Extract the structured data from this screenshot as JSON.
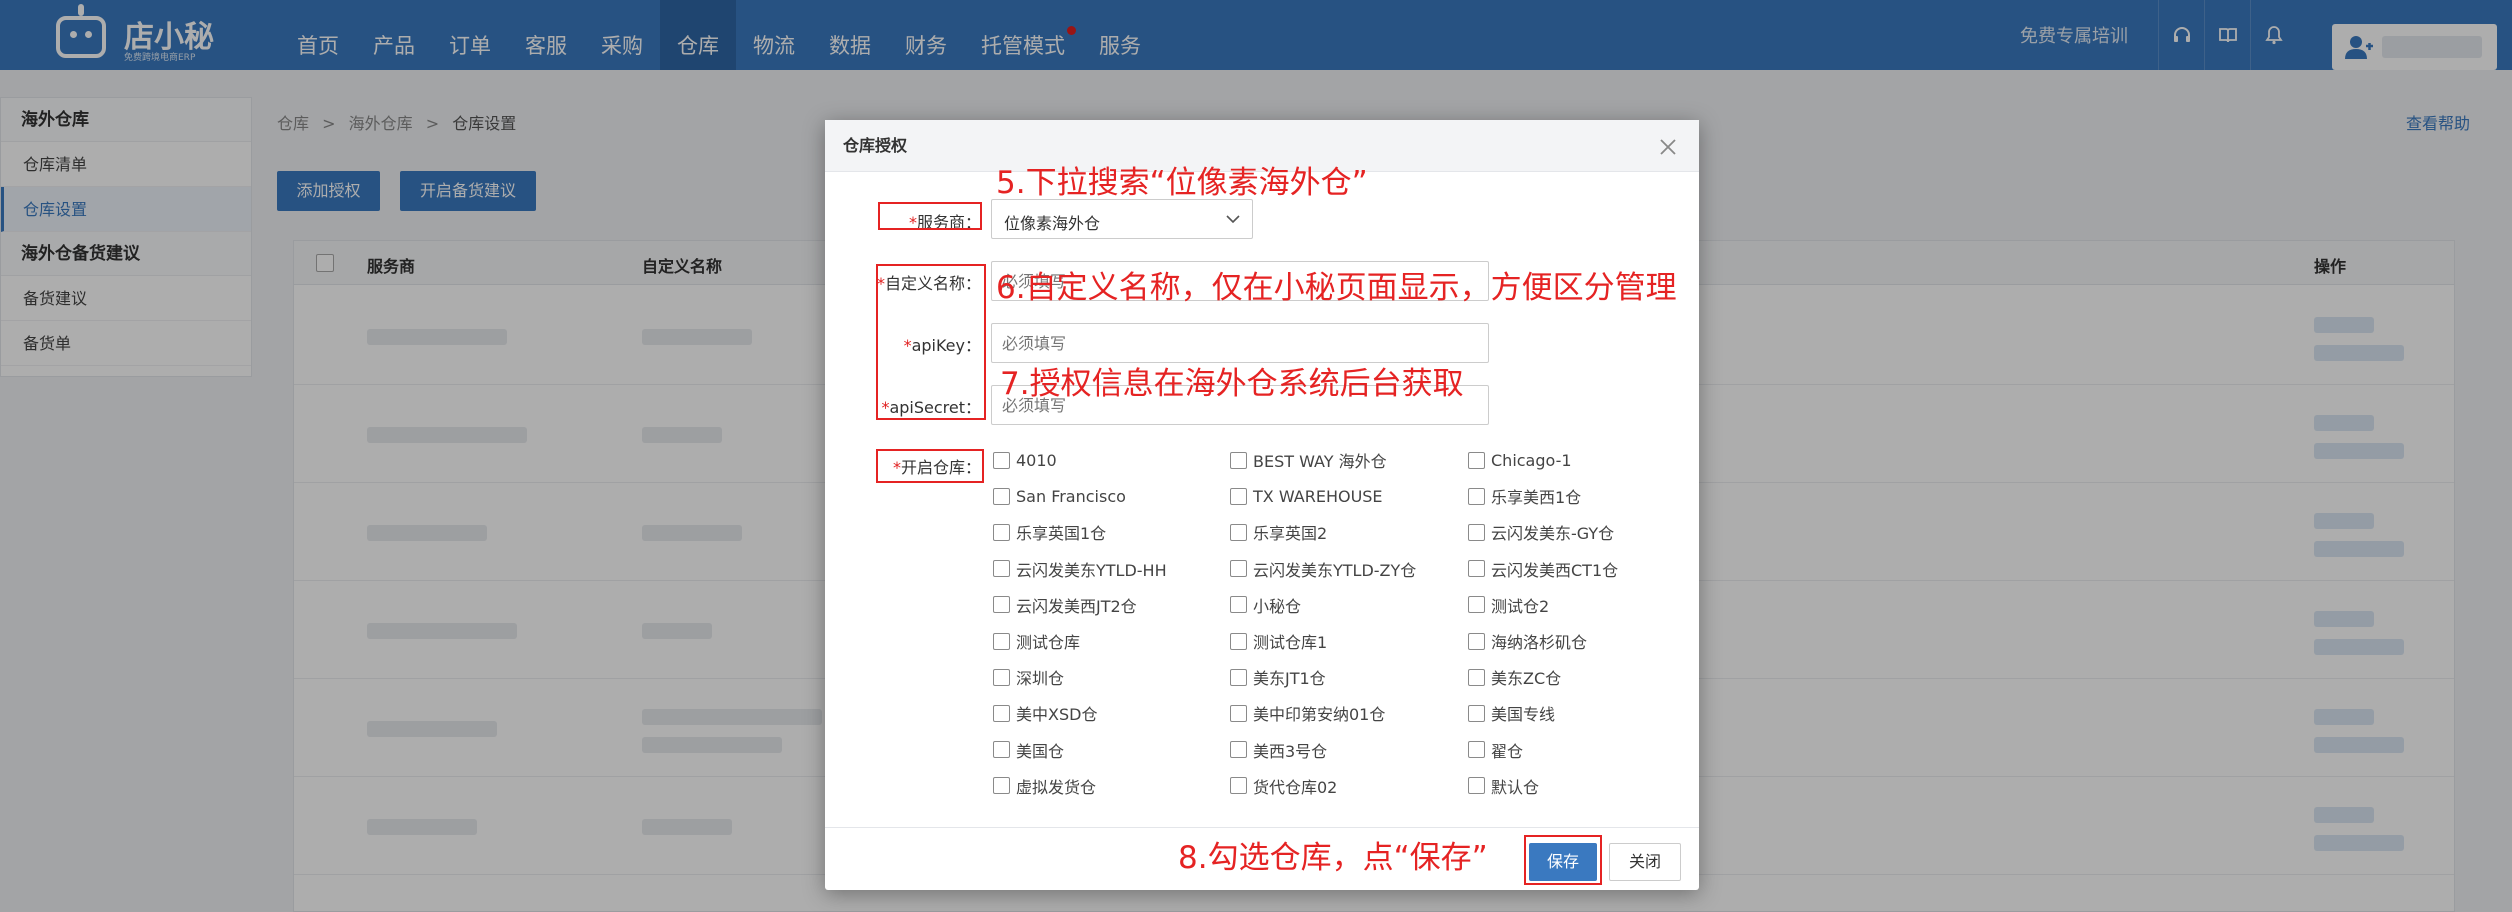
{
  "app": {
    "logo_text": "店小秘",
    "logo_subtitle": "免费跨境电商ERP"
  },
  "nav": {
    "items": [
      {
        "label": "首页"
      },
      {
        "label": "产品"
      },
      {
        "label": "订单"
      },
      {
        "label": "客服"
      },
      {
        "label": "采购"
      },
      {
        "label": "仓库",
        "active": true
      },
      {
        "label": "物流"
      },
      {
        "label": "数据"
      },
      {
        "label": "财务"
      },
      {
        "label": "托管模式",
        "badge_dot": true
      },
      {
        "label": "服务"
      }
    ],
    "training_link": "免费专属培训",
    "icons": [
      "headset-icon",
      "book-icon",
      "bell-icon"
    ],
    "user_icon": "user-icon"
  },
  "sidebar": {
    "group1": {
      "title": "海外仓库",
      "items": [
        {
          "label": "仓库清单"
        },
        {
          "label": "仓库设置",
          "active": true
        }
      ]
    },
    "group2": {
      "title": "海外仓备货建议",
      "items": [
        {
          "label": "备货建议"
        },
        {
          "label": "备货单"
        }
      ]
    }
  },
  "breadcrumb": {
    "items": [
      "仓库",
      "海外仓库",
      "仓库设置"
    ],
    "separator": ">"
  },
  "help_link": "查看帮助",
  "toolbar": {
    "add_auth": "添加授权",
    "enable_stock": "开启备货建议"
  },
  "table": {
    "columns": [
      "服务商",
      "自定义名称",
      "操作"
    ]
  },
  "modal": {
    "title": "仓库授权",
    "fields": {
      "provider": {
        "label": "服务商",
        "value": "位像素海外仓"
      },
      "custom_name": {
        "label": "自定义名称",
        "placeholder": "必须填写"
      },
      "api_key": {
        "label": "apiKey",
        "placeholder": "必须填写"
      },
      "api_secret": {
        "label": "apiSecret",
        "placeholder": "必须填写"
      },
      "warehouses_label": "开启仓库"
    },
    "label_suffix": "：",
    "required_mark": "*",
    "warehouses": [
      "4010",
      "BEST WAY 海外仓",
      "Chicago-1",
      "San Francisco",
      "TX WAREHOUSE",
      "乐享美西1仓",
      "乐享英国1仓",
      "乐享英国2",
      "云闪发美东-GY仓",
      "云闪发美东YTLD-HH",
      "云闪发美东YTLD-ZY仓",
      "云闪发美西CT1仓",
      "云闪发美西JT2仓",
      "小秘仓",
      "测试仓2",
      "测试仓库",
      "测试仓库1",
      "海纳洛杉矶仓",
      "深圳仓",
      "美东JT1仓",
      "美东ZC仓",
      "美中XSD仓",
      "美中印第安纳01仓",
      "美国专线",
      "美国仓",
      "美西3号仓",
      "翟仓",
      "虚拟发货仓",
      "货代仓库02",
      "默认仓"
    ],
    "save_label": "保存",
    "close_label": "关闭"
  },
  "annotations": {
    "step5": "5.下拉搜索“位像素海外仓”",
    "step6": "6.自定义名称，仅在小秘页面显示，方便区分管理",
    "step7": "7.授权信息在海外仓系统后台获取",
    "step8": "8.勾选仓库，点“保存”"
  },
  "colors": {
    "brand": "#3a79c0",
    "nav_active": "#2f66a6",
    "annotation": "#e52323",
    "required": "#e02020"
  }
}
